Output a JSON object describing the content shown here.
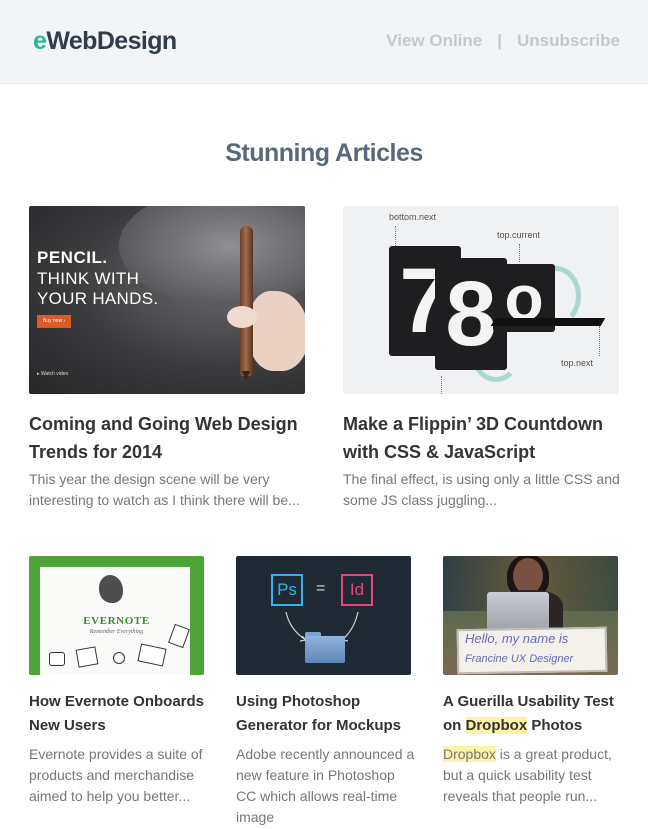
{
  "header": {
    "logo_accent": "e",
    "logo_rest": "WebDesign",
    "view_online": "View Online",
    "separator": "|",
    "unsubscribe": "Unsubscribe"
  },
  "section_title": "Stunning Articles",
  "colors": {
    "brand_teal": "#27b89b",
    "brand_dark": "#2f3d4e",
    "title_gray": "#58697c",
    "highlight": "#fff3a8"
  },
  "articles": [
    {
      "title": "Coming and Going Web Design Trends for 2014",
      "desc": "This year the design scene will be very interesting to watch as I think there will be...",
      "image": {
        "headline": "PENCIL.",
        "line1": "THINK WITH",
        "line2": "YOUR HANDS.",
        "buy": "Buy now ›",
        "watch": "▸ Watch video"
      }
    },
    {
      "title": "Make a Flippin’ 3D Countdown with CSS & JavaScript",
      "desc": "The final effect, is using only a little CSS and some JS class juggling...",
      "image": {
        "label_bottom_next": "bottom.next",
        "label_top_current": "top.current",
        "label_top_next": "top.next",
        "digit_1": "7",
        "digit_2": "8",
        "digit_3": "o"
      }
    },
    {
      "title": "How Evernote Onboards New Users",
      "desc": "Evernote provides a suite of products and merchandise aimed to help you better...",
      "image": {
        "brand": "EVERNOTE",
        "tagline": "Remember Everything"
      }
    },
    {
      "title": "Using Photoshop Generator for Mockups",
      "desc": "Adobe recently announced a new feature in Photoshop CC which allows real-time image",
      "image": {
        "ps": "Ps",
        "eq": "=",
        "id": "Id"
      }
    },
    {
      "title_pre": "A Guerilla Usability Test on ",
      "title_hl": "Dropbox",
      "title_post": " Photos",
      "desc_hl": "Dropbox",
      "desc_rest": " is a great product, but a quick usability test reveals that people run...",
      "image": {
        "sign_line1": "Hello, my name is",
        "sign_line2": "Francine UX Designer"
      }
    }
  ]
}
